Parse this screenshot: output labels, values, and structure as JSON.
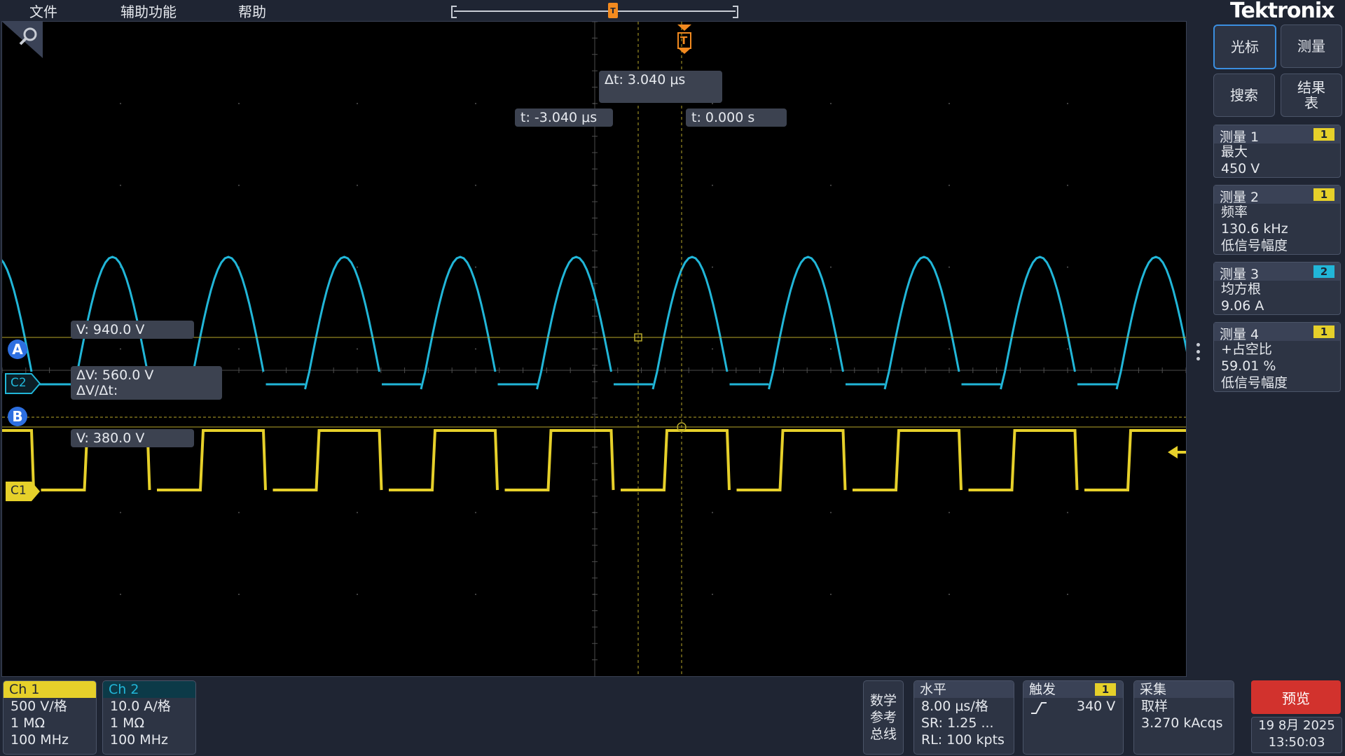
{
  "menu": {
    "file": "文件",
    "utilities": "辅助功能",
    "help": "帮助"
  },
  "brand": {
    "logo": "Tektronix"
  },
  "timeline": {
    "position_marker": "T"
  },
  "trigger_marker": "T",
  "readouts": {
    "delta_t": "Δt:  3.040  μs",
    "t_a": "t:    -3.040  μs",
    "t_b": "t:    0.000  s",
    "v_a": "V:   940.0  V",
    "delta_v": "ΔV:        560.0  V",
    "delta_v_dt": "ΔV/Δt:",
    "v_b": "V:   380.0  V"
  },
  "markers": {
    "cursor_a": "A",
    "cursor_b": "B",
    "ch2": "C2",
    "ch1": "C1"
  },
  "right_panel": {
    "cursor_btn": "光标",
    "measure_btn": "测量",
    "search_btn": "搜索",
    "results_btn_line1": "结果",
    "results_btn_line2": "表",
    "measurements": [
      {
        "title": "测量 1",
        "badge": "1",
        "lines": [
          "最大",
          "450 V"
        ]
      },
      {
        "title": "测量 2",
        "badge": "1",
        "lines": [
          "频率",
          "130.6 kHz",
          "低信号幅度"
        ]
      },
      {
        "title": "测量 3",
        "badge": "2",
        "lines": [
          "均方根",
          "9.06 A"
        ]
      },
      {
        "title": "测量 4",
        "badge": "1",
        "lines": [
          "+占空比",
          "59.01 %",
          "低信号幅度"
        ]
      }
    ]
  },
  "bottom": {
    "ch1": {
      "title": "Ch 1",
      "scale": "500 V/格",
      "impedance": "1 MΩ",
      "bw": "100 MHz"
    },
    "ch2": {
      "title": "Ch 2",
      "scale": "10.0 A/格",
      "impedance": "1 MΩ",
      "bw": "100 MHz"
    },
    "math": {
      "l1": "数学",
      "l2": "参考",
      "l3": "总线"
    },
    "horizontal": {
      "title": "水平",
      "scale": "8.00 μs/格",
      "sr": "SR: 1.25 ...",
      "rl": "RL: 100 kpts"
    },
    "trigger": {
      "title": "触发",
      "badge": "1",
      "level": "340 V"
    },
    "acquire": {
      "title": "采集",
      "mode": "取样",
      "count": "3.270 kAcqs"
    },
    "preview": "预览",
    "date": "19 8月 2025",
    "time": "13:50:03"
  },
  "colors": {
    "ch1": "#e6d02a",
    "ch2": "#21b6d8",
    "cursor": "#b8a92a",
    "accent_orange": "#f28a1f"
  }
}
